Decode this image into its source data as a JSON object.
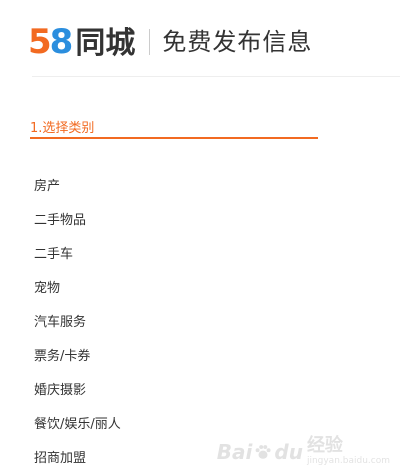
{
  "header": {
    "logo_number_5": "5",
    "logo_number_8": "8",
    "logo_text": "同城",
    "title": "免费发布信息"
  },
  "step": {
    "label": "1.选择类别"
  },
  "categories": [
    {
      "label": "房产"
    },
    {
      "label": "二手物品"
    },
    {
      "label": "二手车"
    },
    {
      "label": "宠物"
    },
    {
      "label": "汽车服务"
    },
    {
      "label": "票务/卡券"
    },
    {
      "label": "婚庆摄影"
    },
    {
      "label": "餐饮/娱乐/丽人"
    },
    {
      "label": "招商加盟"
    }
  ],
  "watermark": {
    "brand": "Bai",
    "brand_tail": "du",
    "cn": "经验",
    "url": "jingyan.baidu.com"
  },
  "colors": {
    "accent": "#f26a21",
    "logo_blue": "#2b8ede",
    "logo_yellow": "#f5a623",
    "text": "#333333"
  }
}
